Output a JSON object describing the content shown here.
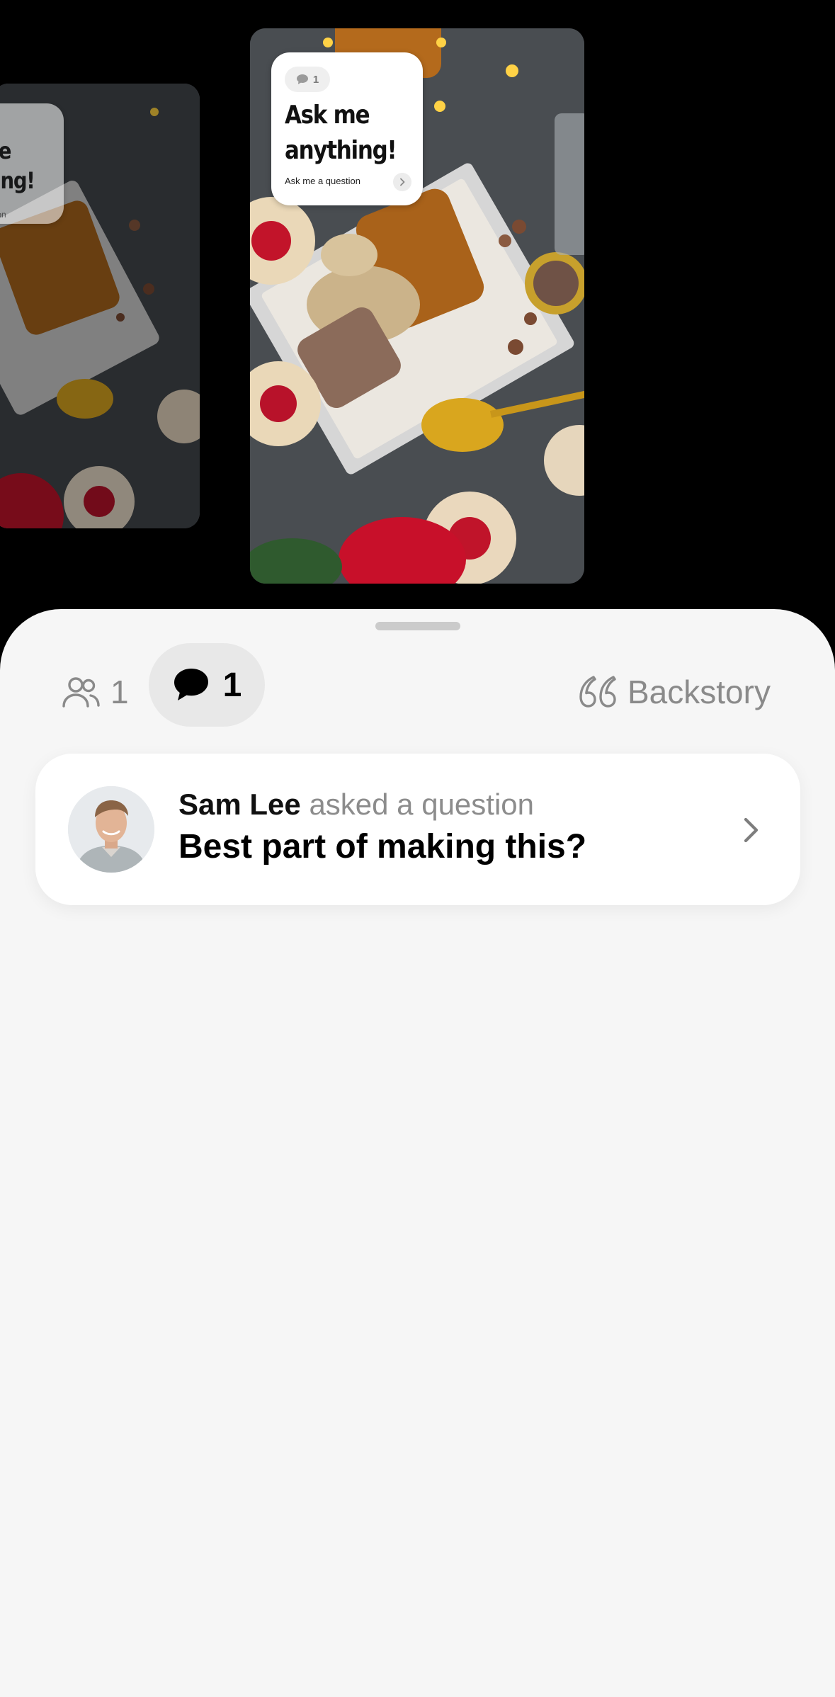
{
  "stories": {
    "previous": {
      "sticker_title": "Ask me\nanything!",
      "sticker_subtitle": "Ask me a question"
    },
    "current": {
      "sticker_count": "1",
      "sticker_title": "Ask me\nanything!",
      "sticker_subtitle": "Ask me a question"
    }
  },
  "tabs": {
    "viewers_count": "1",
    "questions_count": "1",
    "backstory_label": "Backstory"
  },
  "question": {
    "author": "Sam Lee",
    "action": "asked a question",
    "text": "Best part of making this?"
  },
  "icons": {
    "viewers": "people-icon",
    "questions": "speech-bubble-icon",
    "backstory": "quote-icon",
    "open": "chevron-right-icon"
  },
  "colors": {
    "sheet_background": "#f6f6f6",
    "active_tab_background": "#e8e8e8",
    "muted_text": "#8a8a8a"
  }
}
